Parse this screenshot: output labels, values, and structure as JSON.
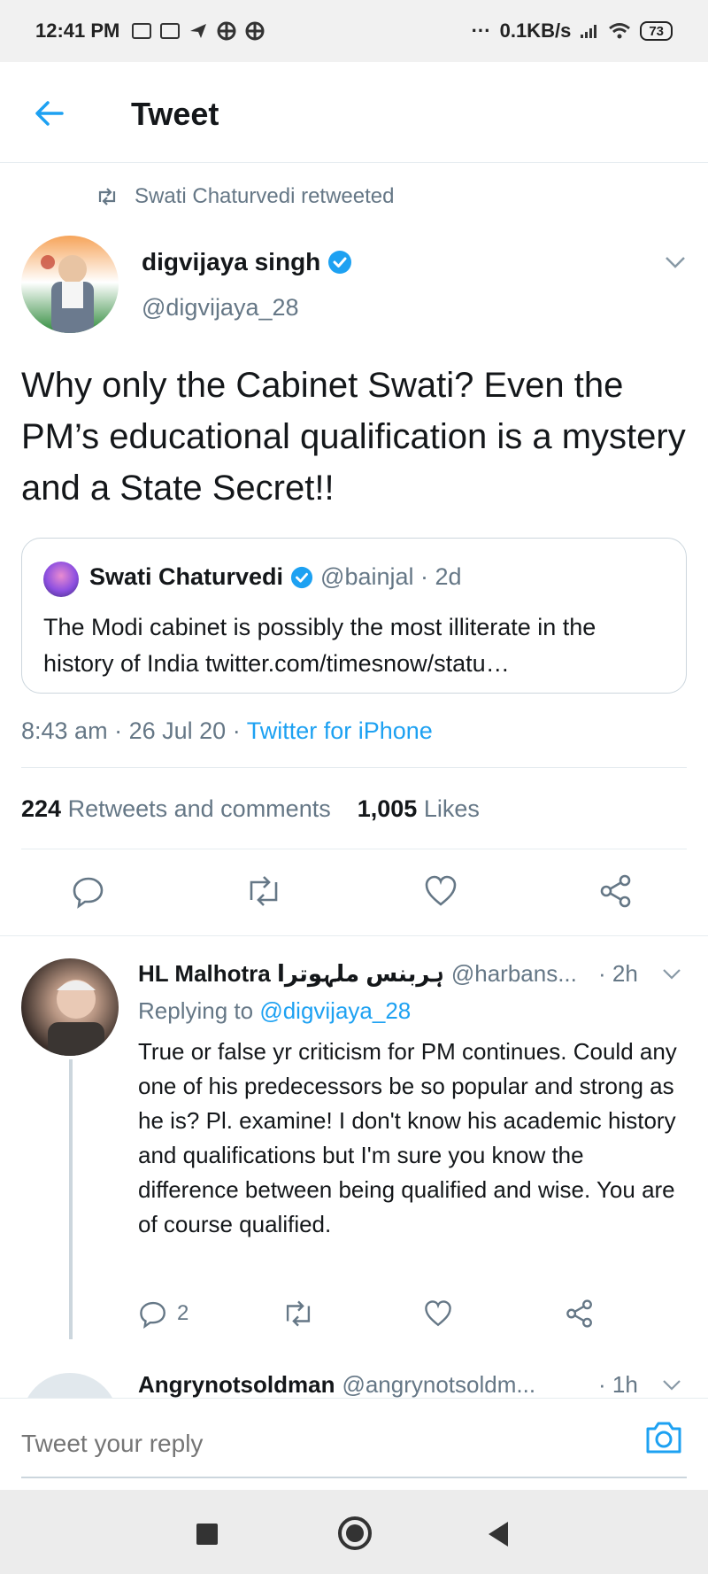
{
  "status_bar": {
    "time": "12:41 PM",
    "network_speed": "0.1KB/s",
    "battery": "73",
    "dots": "···",
    "icons": [
      "message-icon",
      "message-icon",
      "send-icon",
      "grid-icon",
      "grid-icon",
      "signal-icon",
      "wifi-icon"
    ]
  },
  "header": {
    "title": "Tweet",
    "back_icon": "arrow-left-icon"
  },
  "retweet_context": {
    "text": "Swati Chaturvedi retweeted",
    "icon": "retweet-icon"
  },
  "tweet": {
    "author_name": "digvijaya singh",
    "author_handle": "@digvijaya_28",
    "verified": true,
    "text": "Why only the Cabinet Swati? Even the PM’s educational qualification is a mystery and a State Secret!!",
    "quote": {
      "author_name": "Swati Chaturvedi",
      "meta": "@bainjal · 2d",
      "text": "The Modi cabinet is possibly the most illiterate in the history of India twitter.com/timesnow/statu…"
    },
    "time": "8:43 am",
    "separator": "·",
    "date": "26 Jul 20",
    "source": "Twitter for iPhone",
    "retweets_count": "224",
    "retweets_label": "Retweets and comments",
    "likes_count": "1,005",
    "likes_label": "Likes"
  },
  "reply": {
    "author_name": "HL Malhotra ہربنس ملہوترا",
    "author_handle": "@harbans...",
    "time": "· 2h",
    "replying_prefix": "Replying to",
    "replying_to": "@digvijaya_28",
    "text": "True or false yr criticism for PM continues. Could any one of his predecessors be so popular and strong as he is? Pl. examine! I don't know his academic history and qualifications but I'm sure you know the difference between being qualified and wise. You are of course qualified.",
    "reply_count": "2"
  },
  "next_reply": {
    "author_name": "Angrynotsoldman",
    "author_handle": "@angrynotsoldm...",
    "time": "· 1h"
  },
  "composer": {
    "placeholder": "Tweet your reply"
  },
  "colors": {
    "accent": "#1da1f2",
    "muted": "#657786",
    "text": "#14171a",
    "border": "#e6ecf0"
  }
}
